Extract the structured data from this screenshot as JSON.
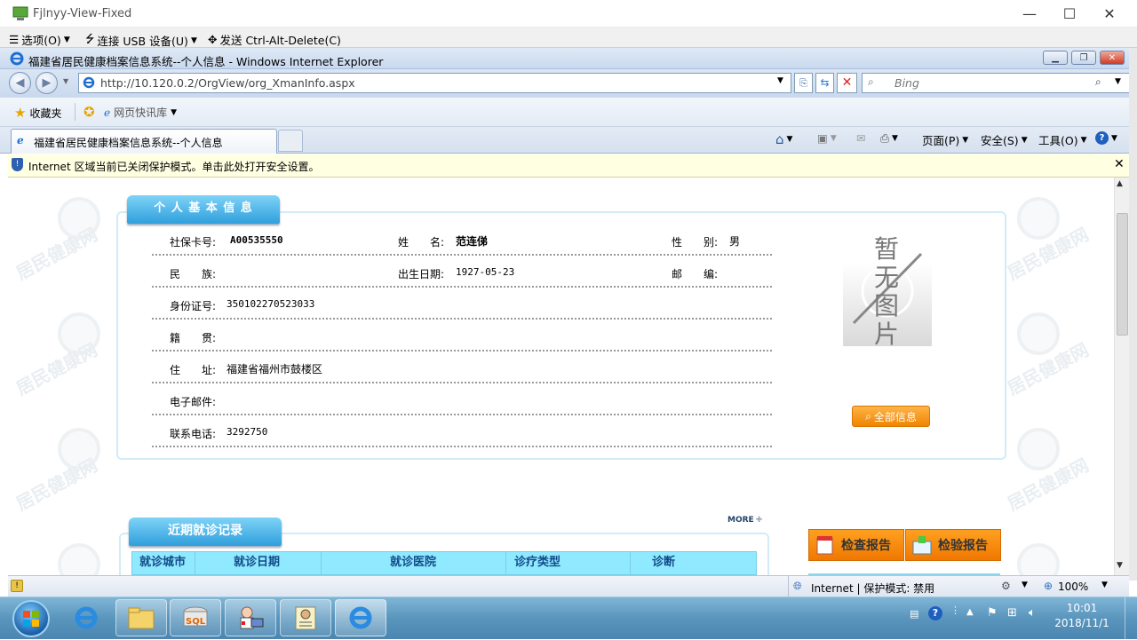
{
  "outer_window": {
    "title": "Fjlnyy-View-Fixed",
    "minimize": "—",
    "maximize": "☐",
    "close": "✕"
  },
  "vdi_menu": {
    "options": "选项(O)",
    "usb": "连接 USB 设备(U)",
    "cad": "发送 Ctrl-Alt-Delete(C)"
  },
  "ie": {
    "title": "福建省居民健康档案信息系统--个人信息 - Windows Internet Explorer",
    "address": "http://10.120.0.2/OrgView/org_XmanInfo.aspx",
    "search_placeholder": "Bing",
    "favorites": "收藏夹",
    "web_slice": "网页快讯库",
    "tab_title": "福建省居民健康档案信息系统--个人信息",
    "cmd_page": "页面(P)",
    "cmd_safety": "安全(S)",
    "cmd_tools": "工具(O)",
    "infobar": "Internet 区域当前已关闭保护模式。单击此处打开安全设置。",
    "info_close": "✕"
  },
  "watermark": "居民健康网",
  "personal": {
    "header": "个 人 基 本 信 息",
    "fields": {
      "ssn_label": "社保卡号:",
      "ssn": "A00535550",
      "name_label": "姓　　名:",
      "name": "范连俤",
      "gender_label": "性　　别:",
      "gender": "男",
      "ethnic_label": "民　　族:",
      "ethnic": "",
      "birth_label": "出生日期:",
      "birth": "1927-05-23",
      "zip_label": "邮　　编:",
      "zip": "",
      "id_label": "身份证号:",
      "id": "350102270523033",
      "native_label": "籍　　贯:",
      "native": "",
      "addr_label": "住　　址:",
      "addr": "福建省福州市鼓楼区",
      "email_label": "电子邮件:",
      "email": "",
      "phone_label": "联系电话:",
      "phone": "3292750"
    },
    "photo_text": [
      "暂",
      "无",
      "图",
      "片"
    ],
    "all_info_btn": "全部信息"
  },
  "visits": {
    "header": "近期就诊记录",
    "more": "MORE",
    "columns": [
      "就诊城市",
      "就诊日期",
      "就诊医院",
      "诊疗类型",
      "诊断"
    ]
  },
  "reports": {
    "check": "检查报告",
    "lab": "检验报告"
  },
  "statusbar": {
    "zone": "Internet | 保护模式: 禁用",
    "zoom": "100%"
  },
  "clock": {
    "time": "10:01",
    "date": "2018/11/1"
  }
}
